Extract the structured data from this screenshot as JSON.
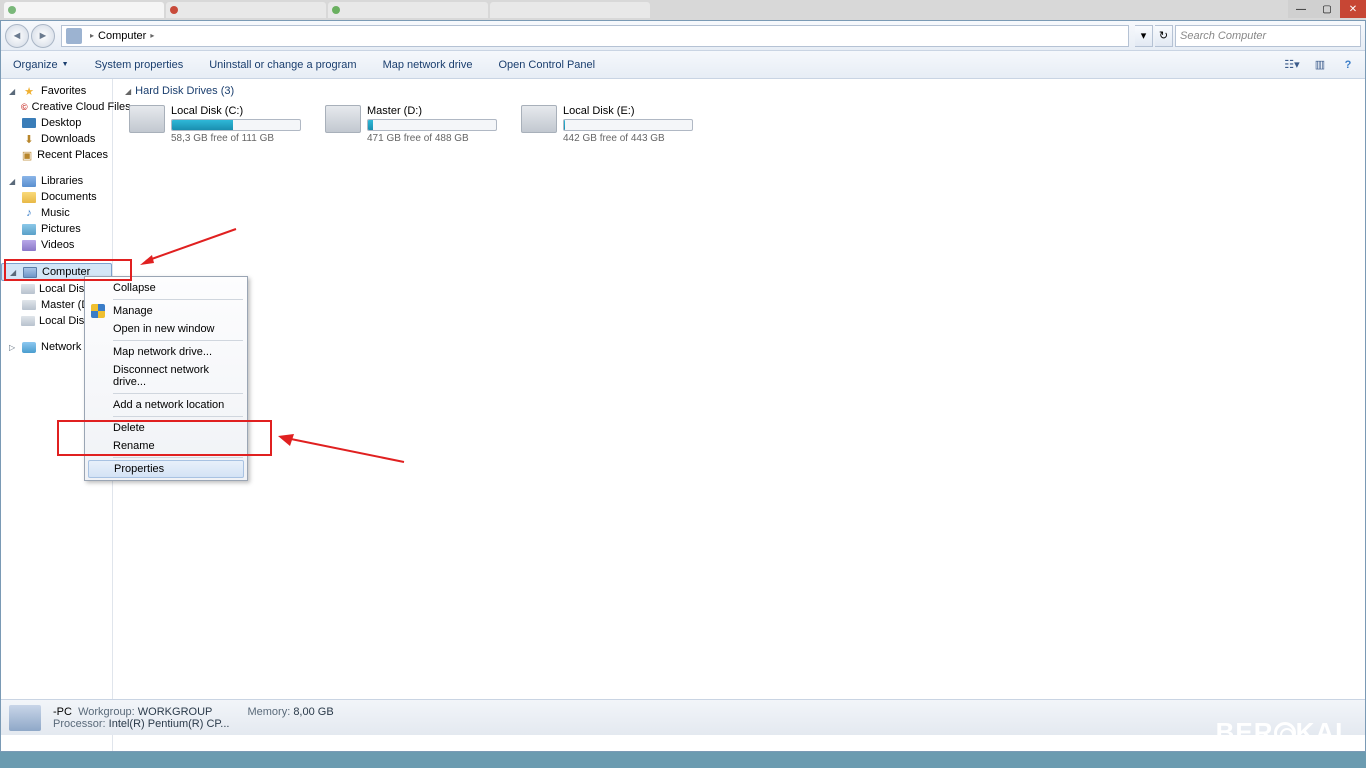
{
  "browser": {
    "win_min": "—",
    "win_max": "▢",
    "win_close": "✕"
  },
  "address": {
    "location_label": "Computer",
    "search_placeholder": "Search Computer",
    "arrow": "▸",
    "dropdown": "▾",
    "refresh": "↻"
  },
  "commands": {
    "organize": "Organize",
    "items": [
      "System properties",
      "Uninstall or change a program",
      "Map network drive",
      "Open Control Panel"
    ],
    "help": "?"
  },
  "tree": {
    "favorites": {
      "label": "Favorites",
      "items": [
        "Creative Cloud Files",
        "Desktop",
        "Downloads",
        "Recent Places"
      ]
    },
    "libraries": {
      "label": "Libraries",
      "items": [
        "Documents",
        "Music",
        "Pictures",
        "Videos"
      ]
    },
    "computer": {
      "label": "Computer",
      "items": [
        "Local Disk (C:)",
        "Master (D:)",
        "Local Disk (E:)"
      ]
    },
    "network": {
      "label": "Network"
    }
  },
  "content": {
    "section": "Hard Disk Drives (3)",
    "drives": [
      {
        "name": "Local Disk (C:)",
        "free": "58,3 GB free of 111 GB",
        "fill": 48
      },
      {
        "name": "Master (D:)",
        "free": "471 GB free of 488 GB",
        "fill": 4
      },
      {
        "name": "Local Disk (E:)",
        "free": "442 GB free of 443 GB",
        "fill": 1
      }
    ]
  },
  "context_menu": {
    "items": [
      {
        "label": "Collapse"
      },
      {
        "sep": true
      },
      {
        "label": "Manage",
        "shield": true
      },
      {
        "label": "Open in new window"
      },
      {
        "sep": true
      },
      {
        "label": "Map network drive..."
      },
      {
        "label": "Disconnect network drive..."
      },
      {
        "sep": true
      },
      {
        "label": "Add a network location"
      },
      {
        "sep": true
      },
      {
        "label": "Delete"
      },
      {
        "label": "Rename"
      },
      {
        "sep": true
      },
      {
        "label": "Properties",
        "selected": true
      }
    ]
  },
  "status": {
    "pc": "-PC",
    "workgroup_label": "Workgroup:",
    "workgroup": "WORKGROUP",
    "memory_label": "Memory:",
    "memory": "8,00 GB",
    "processor_label": "Processor:",
    "processor": "Intel(R) Pentium(R) CP..."
  },
  "watermark": "BERAKAL"
}
